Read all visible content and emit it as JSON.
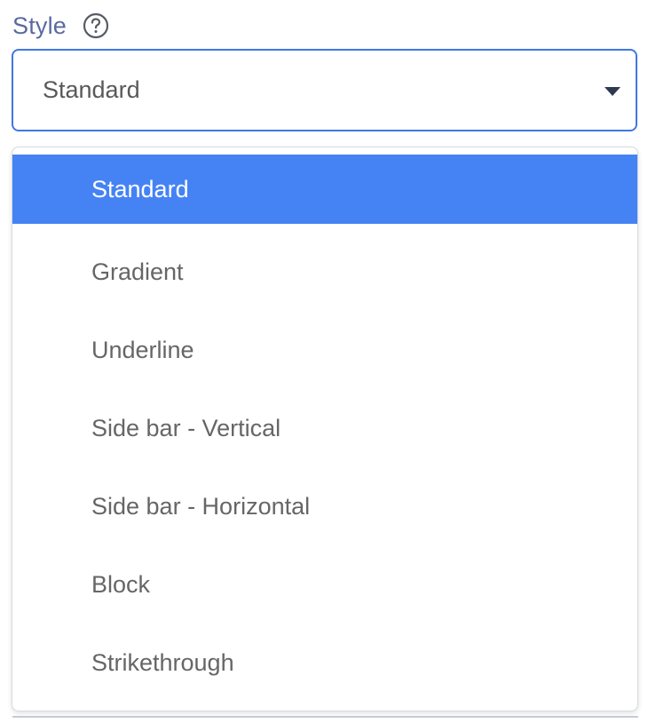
{
  "field": {
    "label": "Style",
    "help_icon": "question-circle-icon"
  },
  "select": {
    "value": "Standard",
    "caret_icon": "caret-down-icon"
  },
  "dropdown": {
    "selected_index": 0,
    "options": [
      "Standard",
      "Gradient",
      "Underline",
      "Side bar - Vertical",
      "Side bar - Horizontal",
      "Block",
      "Strikethrough"
    ]
  },
  "colors": {
    "accent": "#3f78e0",
    "selected_bg": "#4583f4",
    "label": "#5a6aa0",
    "option_text": "#666666"
  }
}
